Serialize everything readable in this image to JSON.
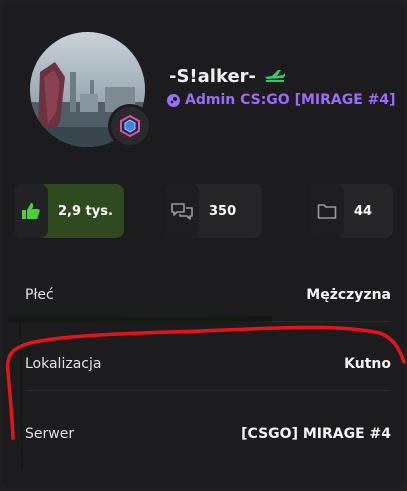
{
  "profile": {
    "username": "-S!alker-",
    "role": "Admin CS:GO [MIRAGE #4]",
    "colors": {
      "role": "#9b6cf5",
      "badge": "#2ecc71"
    },
    "icons": {
      "username_badge": "plane-icon",
      "role": "steam-icon",
      "rank": "rank-emblem-icon"
    }
  },
  "stats": [
    {
      "icon": "thumbs-up-icon",
      "value": "2,9 tys."
    },
    {
      "icon": "speech-bubbles-icon",
      "value": "350"
    },
    {
      "icon": "folder-icon",
      "value": "44"
    }
  ],
  "info": [
    {
      "label": "Płeć",
      "value": "Mężczyzna"
    },
    {
      "label": "Lokalizacja",
      "value": "Kutno"
    },
    {
      "label": "Serwer",
      "value": "[CSGO] MIRAGE #4"
    }
  ],
  "colors": {
    "likes_accent": "#2f4a1e",
    "annotation": "#e5141b"
  }
}
